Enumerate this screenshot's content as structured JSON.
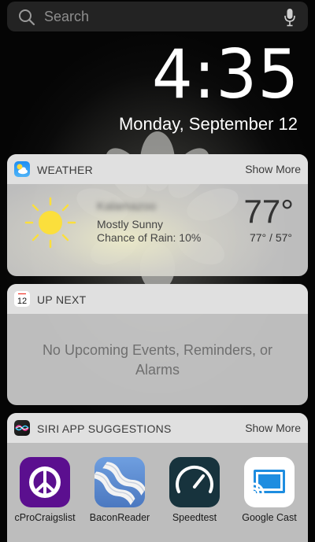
{
  "search": {
    "placeholder": "Search",
    "icon": "search-icon",
    "mic_icon": "microphone-icon"
  },
  "lock": {
    "time": "4:35",
    "date": "Monday, September 12"
  },
  "weather": {
    "title": "WEATHER",
    "action": "Show More",
    "location": "Kalamazoo",
    "condition": "Mostly Sunny",
    "rain": "Chance of Rain: 10%",
    "temperature": "77°",
    "high_low": "77° / 57°",
    "icon": "sun-icon"
  },
  "up_next": {
    "title": "UP NEXT",
    "calendar_day": "12",
    "message": "No Upcoming Events, Reminders, or Alarms"
  },
  "siri": {
    "title": "SIRI APP SUGGESTIONS",
    "action": "Show More",
    "apps": [
      {
        "label": "cProCraigslist",
        "icon": "peace-sign-icon",
        "color": "#5b0f8f"
      },
      {
        "label": "BaconReader",
        "icon": "bacon-icon",
        "color": "#5f8fd0"
      },
      {
        "label": "Speedtest",
        "icon": "speedometer-icon",
        "color": "#17333d"
      },
      {
        "label": "Google Cast",
        "icon": "cast-icon",
        "color": "#1e8de0"
      }
    ]
  },
  "colors": {
    "widget_bg": "#cdcdcd",
    "widget_header": "#e1e1e1",
    "sun": "#fbdf3c"
  }
}
